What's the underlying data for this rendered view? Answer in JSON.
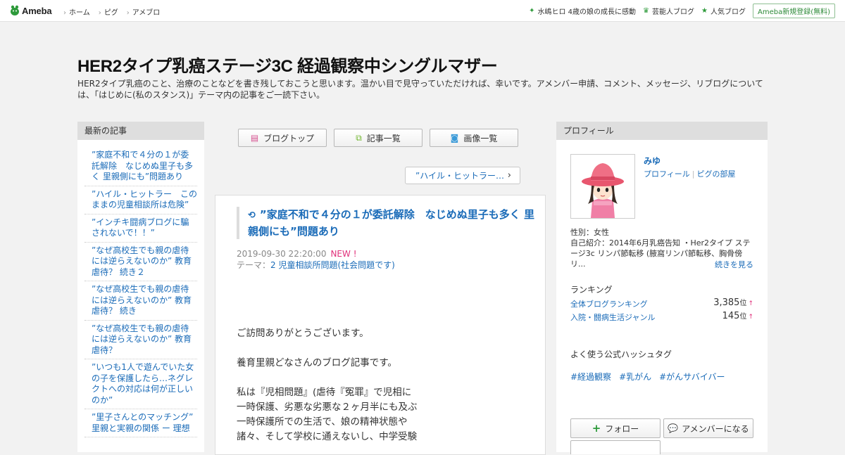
{
  "topbar": {
    "logo_text": "Ameba",
    "nav": [
      "ホーム",
      "ピグ",
      "アメブロ"
    ],
    "links": [
      {
        "icon": "sparkle-icon",
        "label": "水嶋ヒロ 4歳の娘の成長に感動"
      },
      {
        "icon": "crown-icon",
        "label": "芸能人ブログ"
      },
      {
        "icon": "star-icon",
        "label": "人気ブログ"
      }
    ],
    "register_label": "Ameba新規登録(無料)"
  },
  "blog": {
    "title": "HER2タイプ乳癌ステージ3C 経過観察中シングルマザー",
    "description": "HER2タイプ乳癌のこと、治療のことなどを書き残しておこうと思います。温かい目で見守っていただければ、幸いです。アメンバー申請、コメント、メッセージ、リブログについては、「はじめに(私のスタンス)」テーマ内の記事をご一読下さい。"
  },
  "left": {
    "heading": "最新の記事",
    "items": [
      "”家庭不和で４分の１が委託解除　なじめぬ里子も多く 里親側にも”問題あり",
      "”ハイル・ヒットラー　このままの児童相談所は危険”",
      "”インチキ闘病ブログに騙されないで！！”",
      "”なぜ高校生でも親の虐待には逆らえないのか” 教育虐待？ 続き２",
      "”なぜ高校生でも親の虐待には逆らえないのか” 教育虐待？ 続き",
      "”なぜ高校生でも親の虐待には逆らえないのか” 教育虐待？",
      "”いつも1人で遊んでいた女の子を保護したら…ネグレクトへの対応は何が正しいのか”",
      "”里子さんとのマッチング” 里親と実親の関係 ー 理想"
    ]
  },
  "center": {
    "buttons": [
      {
        "icon": "document-icon",
        "label": "ブログトップ"
      },
      {
        "icon": "list-icon",
        "label": "記事一覧"
      },
      {
        "icon": "camera-icon",
        "label": "画像一覧"
      }
    ],
    "prev_post": "”ハイル・ヒットラー…",
    "article": {
      "title": "”家庭不和で４分の１が委託解除　なじめぬ里子も多く 里親側にも”問題あり",
      "date": "2019-09-30 22:20:00",
      "new_label": "NEW !",
      "theme_prefix": "テーマ：",
      "theme": "2 児童相談所問題(社会問題です)",
      "body": [
        "ご訪問ありがとうございます。",
        "",
        "養育里親どなさんのブログ記事です。",
        "",
        "私は『児相問題』(虐待『冤罪』で児相に",
        "一時保護、劣悪な劣悪な２ヶ月半にも及ぶ",
        "一時保護所での生活で、娘の精神状態や",
        "諸々、そして学校に通えないし、中学受験"
      ]
    }
  },
  "right": {
    "heading": "プロフィール",
    "name": "みゆ",
    "profile_link": "プロフィール",
    "pig_link": "ピグの部屋",
    "gender": "性別：女性",
    "intro": "自己紹介：2014年6月乳癌告知 ・Her2タイプ ステージ3c リンパ節転移 (腋窩リンパ節転移、胸骨傍リ...",
    "read_more": "続きを見る",
    "ranking_heading": "ランキング",
    "rankings": [
      {
        "label": "全体ブログランキング",
        "value": "3,385",
        "unit": "位",
        "arrow": "↑"
      },
      {
        "label": "入院・闘病生活ジャンル",
        "value": "145",
        "unit": "位",
        "arrow": "↑"
      }
    ],
    "hashtag_heading": "よく使う公式ハッシュタグ",
    "hashtags": [
      "#経過観察",
      "#乳がん",
      "#がんサバイバー"
    ],
    "follow_label": "フォロー",
    "member_label": "アメンバーになる"
  },
  "colors": {
    "link": "#1a6bb8",
    "accent_green": "#2d9a3a",
    "new_pink": "#e0307a"
  }
}
